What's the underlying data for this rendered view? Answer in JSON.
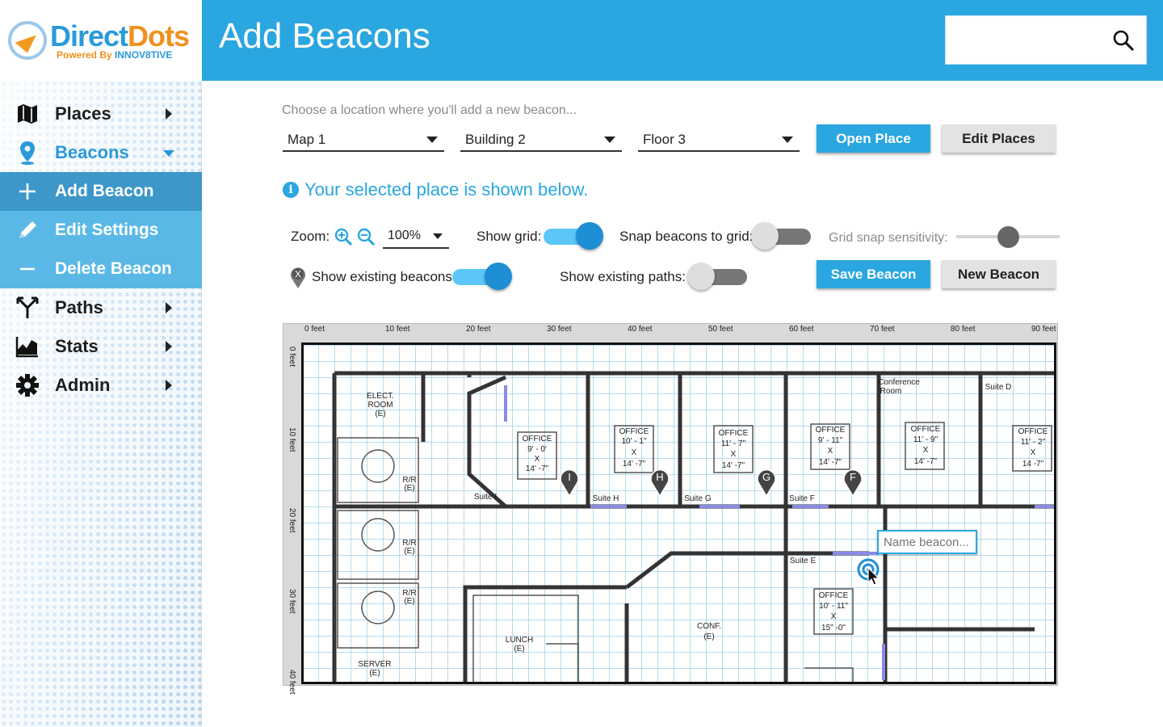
{
  "brand": {
    "name_part1": "Direct",
    "name_part2": "Dots",
    "tagline_part1": "Powered By ",
    "tagline_part2": "INNOV8TIVE"
  },
  "sidebar": {
    "items": [
      {
        "label": "Places",
        "icon": "map-icon"
      },
      {
        "label": "Beacons",
        "icon": "location-pin-icon",
        "expanded": true
      },
      {
        "label": "Paths",
        "icon": "fork-icon"
      },
      {
        "label": "Stats",
        "icon": "chart-icon"
      },
      {
        "label": "Admin",
        "icon": "gear-icon"
      }
    ],
    "beacon_subitems": [
      {
        "label": "Add Beacon",
        "icon": "plus-icon",
        "active": true
      },
      {
        "label": "Edit Settings",
        "icon": "pencil-icon"
      },
      {
        "label": "Delete Beacon",
        "icon": "minus-icon"
      }
    ]
  },
  "header": {
    "title": "Add Beacons",
    "search_placeholder": ""
  },
  "location": {
    "prompt": "Choose a location where you'll add a new beacon...",
    "map": "Map 1",
    "building": "Building 2",
    "floor": "Floor 3",
    "open_button": "Open Place",
    "edit_button": "Edit Places"
  },
  "info": {
    "message": "Your selected place is shown below."
  },
  "controls": {
    "zoom_label": "Zoom:",
    "zoom_value": "100%",
    "show_grid_label": "Show grid:",
    "show_grid": true,
    "snap_label": "Snap beacons to grid:",
    "snap": false,
    "sensitivity_label": "Grid snap sensitivity:",
    "sensitivity_value": 0.5,
    "existing_beacons_label": "Show existing beacons:",
    "existing_beacons": true,
    "existing_paths_label": "Show existing paths:",
    "existing_paths": false,
    "save_button": "Save Beacon",
    "new_button": "New Beacon",
    "beacon_marker_letter": "X"
  },
  "map": {
    "x_ruler": [
      "0 feet",
      "10 feet",
      "20 feet",
      "30 feet",
      "40 feet",
      "50 feet",
      "60 feet",
      "70 feet",
      "80 feet",
      "90 feet"
    ],
    "y_ruler": [
      "0 feet",
      "10 feet",
      "20 feet",
      "30 feet",
      "40 feet"
    ],
    "beacons": [
      "I",
      "H",
      "G",
      "F"
    ],
    "name_beacon_placeholder": "Name beacon...",
    "rooms": {
      "elect_1": "ELECT.",
      "elect_2": "ROOM",
      "elect_3": "(E)",
      "rr": "R/R",
      "rr_e": "(E)",
      "suite_i": "Suite I",
      "suite_h": "Suite H",
      "suite_g": "Suite G",
      "suite_f": "Suite F",
      "suite_e": "Suite E",
      "suite_d": "Suite D",
      "conference_1": "Conference",
      "conference_2": "Room",
      "office": "OFFICE",
      "x": "X",
      "o1a": "9' - 0'",
      "o1b": "14' -7\"",
      "o2a": "10' - 1\"",
      "o2b": "14' -7\"",
      "o3a": "11' - 7\"",
      "o3b": "14' -7\"",
      "o4a": "9' - 11\"",
      "o4b": "14' -7\"",
      "o5a": "11' - 9\"",
      "o5b": "14' -7\"",
      "o6a": "11' - 2\"",
      "o6b": "14 -7\"",
      "o7a": "10' - 11\"",
      "o7b": "15\" -0\"",
      "lunch": "LUNCH",
      "lunch_e": "(E)",
      "conf": "CONF.",
      "conf_e": "(E)",
      "server": "SERVER",
      "server_e": "(E)"
    }
  }
}
